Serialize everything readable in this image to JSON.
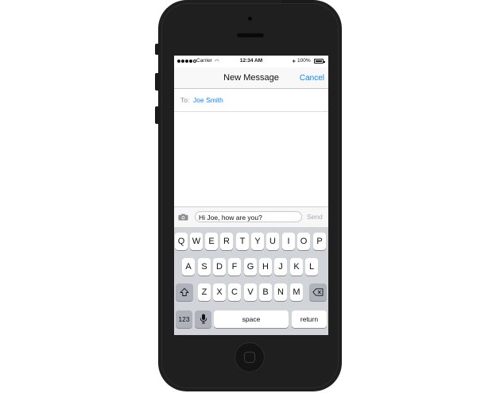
{
  "status_bar": {
    "carrier": "Carrier",
    "time": "12:34 AM",
    "battery": "100%",
    "bluetooth_symbol": "∗",
    "wifi_symbol": "◠"
  },
  "nav": {
    "title": "New Message",
    "cancel": "Cancel"
  },
  "recipient": {
    "label": "To:",
    "name": "Joe Smith"
  },
  "composer": {
    "message": "Hi Joe, how are you?",
    "send": "Send"
  },
  "keyboard": {
    "row1": [
      "Q",
      "W",
      "E",
      "R",
      "T",
      "Y",
      "U",
      "I",
      "O",
      "P"
    ],
    "row2": [
      "A",
      "S",
      "D",
      "F",
      "G",
      "H",
      "J",
      "K",
      "L"
    ],
    "row3": [
      "Z",
      "X",
      "C",
      "V",
      "B",
      "N",
      "M"
    ],
    "numbers_key": "123",
    "space_key": "space",
    "return_key": "return"
  },
  "colors": {
    "accent": "#0a84ff",
    "phone_body": "#1f1f1f",
    "keyboard_bg": "#d1d4d9"
  },
  "icons": [
    "camera-icon",
    "shift-icon",
    "delete-icon",
    "microphone-icon",
    "wifi-icon",
    "bluetooth-icon",
    "battery-icon"
  ]
}
